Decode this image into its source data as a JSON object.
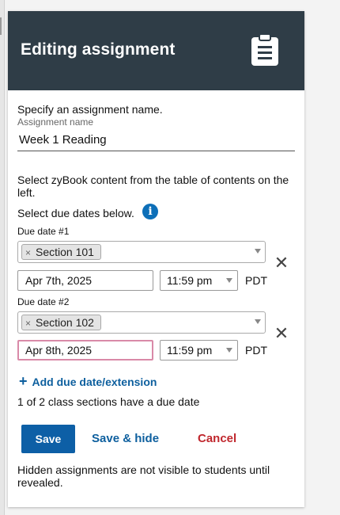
{
  "header": {
    "title": "Editing assignment",
    "icon": "clipboard-icon"
  },
  "name_section": {
    "prompt": "Specify an assignment name.",
    "field_label": "Assignment name",
    "value": "Week 1 Reading"
  },
  "instructions": {
    "content_text": "Select zyBook content from the table of contents on the left.",
    "due_text": "Select due dates below.",
    "info_icon": "info-icon"
  },
  "due_dates": [
    {
      "label": "Due date #1",
      "section": "Section 101",
      "date": "Apr 7th, 2025",
      "time": "11:59 pm",
      "tz": "PDT"
    },
    {
      "label": "Due date #2",
      "section": "Section 102",
      "date": "Apr 8th, 2025",
      "time": "11:59 pm",
      "tz": "PDT"
    }
  ],
  "add_link": "Add due date/extension",
  "status_text": "1 of 2 class sections have a due date",
  "actions": {
    "save": "Save",
    "save_hide": "Save & hide",
    "cancel": "Cancel"
  },
  "footer_note": "Hidden assignments are not visible to students until revealed.",
  "colors": {
    "header_bg": "#2f3d47",
    "primary": "#0d5fa6",
    "cancel": "#c0272d",
    "focus_border": "#d98aa8"
  }
}
